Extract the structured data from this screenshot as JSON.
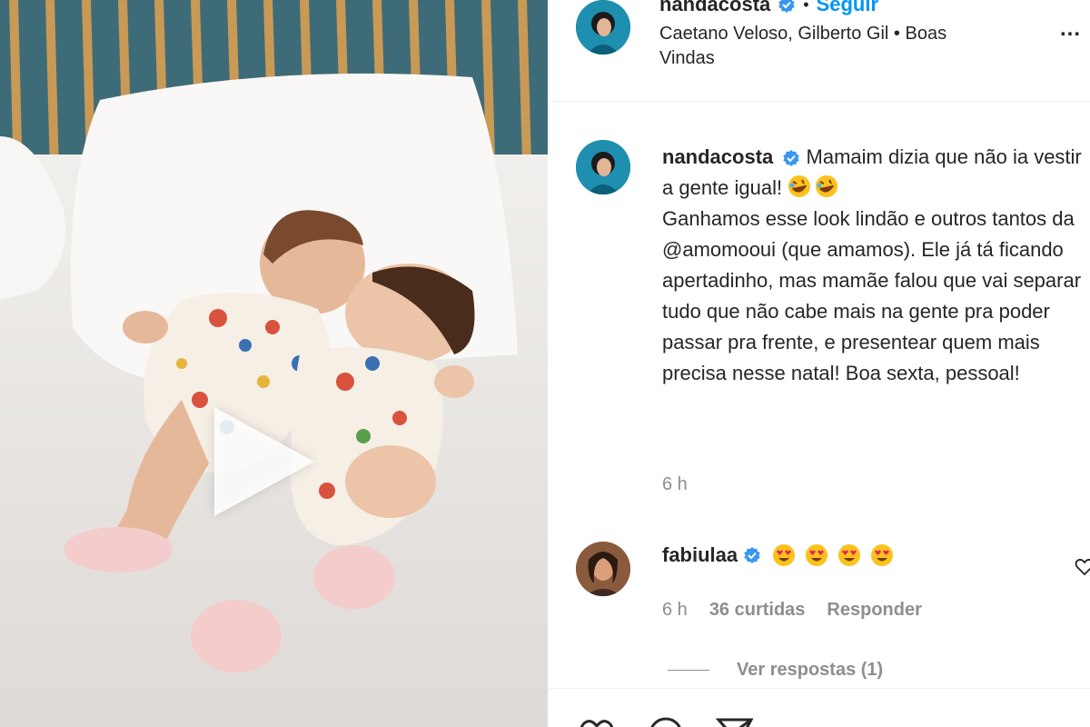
{
  "header": {
    "username": "nandacosta",
    "follow_label": "Seguir",
    "separator": "•",
    "music_line": "Caetano Veloso, Gilberto Gil • Boas Vindas",
    "more_label": "..."
  },
  "caption": {
    "username": "nandacosta",
    "text_part1": "Mamaim dizia que não ia vestir a gente igual!",
    "text_part2": "Ganhamos esse look lindão e outros tantos da",
    "mention": "@amomooui",
    "text_part3": "(que amamos). Ele já tá ficando apertadinho, mas mamãe falou que vai separar tudo que não cabe mais na gente pra poder passar pra frente, e presentear quem mais precisa nesse natal! Boa sexta, pessoal!",
    "emojis": [
      "rofl-emoji",
      "rofl-emoji"
    ],
    "time": "6 h"
  },
  "comment": {
    "username": "fabiulaa",
    "emojis": [
      "heart-eyes-emoji",
      "heart-eyes-emoji",
      "heart-eyes-emoji",
      "heart-eyes-emoji"
    ],
    "time": "6 h",
    "likes": "36 curtidas",
    "reply_label": "Responder",
    "view_replies": "Ver respostas (1)"
  },
  "colors": {
    "link": "#0095f6",
    "text": "#262626",
    "muted": "#8e8e8e",
    "verified": "#3897f0"
  }
}
